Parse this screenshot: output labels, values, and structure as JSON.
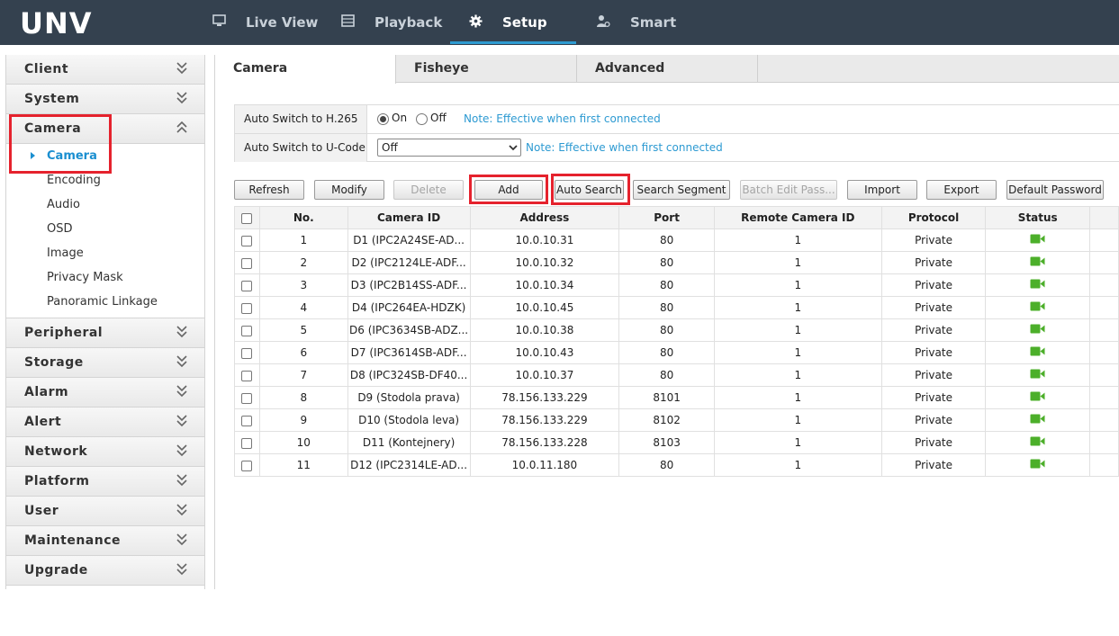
{
  "header": {
    "logo": "UNV",
    "nav": [
      {
        "label": "Live View",
        "icon": "monitor-icon"
      },
      {
        "label": "Playback",
        "icon": "film-icon"
      },
      {
        "label": "Setup",
        "icon": "gear-icon",
        "active": true
      },
      {
        "label": "Smart",
        "icon": "smart-person-icon"
      }
    ]
  },
  "sidebar": {
    "groups": [
      {
        "label": "Client"
      },
      {
        "label": "System"
      },
      {
        "label": "Camera",
        "expanded": true,
        "items": [
          "Camera",
          "Encoding",
          "Audio",
          "OSD",
          "Image",
          "Privacy Mask",
          "Panoramic Linkage"
        ],
        "active_item": "Camera"
      },
      {
        "label": "Peripheral"
      },
      {
        "label": "Storage"
      },
      {
        "label": "Alarm"
      },
      {
        "label": "Alert"
      },
      {
        "label": "Network"
      },
      {
        "label": "Platform"
      },
      {
        "label": "User"
      },
      {
        "label": "Maintenance"
      },
      {
        "label": "Upgrade"
      }
    ]
  },
  "tabs": [
    "Camera",
    "Fisheye",
    "Advanced"
  ],
  "settings": {
    "h265_label": "Auto Switch to H.265",
    "h265_on": "On",
    "h265_off": "Off",
    "h265_value": "On",
    "ucode_label": "Auto Switch to U-Code",
    "ucode_value": "Off",
    "note": "Note: Effective when first connected"
  },
  "toolbar": {
    "refresh": "Refresh",
    "modify": "Modify",
    "delete": "Delete",
    "add": "Add",
    "auto_search": "Auto Search",
    "search_segment": "Search Segment",
    "batch_edit": "Batch Edit Pass...",
    "import": "Import",
    "export": "Export",
    "default_password": "Default Password"
  },
  "table": {
    "columns": [
      "No.",
      "Camera ID",
      "Address",
      "Port",
      "Remote Camera ID",
      "Protocol",
      "Status"
    ],
    "rows": [
      [
        "1",
        "D1 (IPC2A24SE-AD...",
        "10.0.10.31",
        "80",
        "1",
        "Private"
      ],
      [
        "2",
        "D2 (IPC2124LE-ADF...",
        "10.0.10.32",
        "80",
        "1",
        "Private"
      ],
      [
        "3",
        "D3 (IPC2B14SS-ADF...",
        "10.0.10.34",
        "80",
        "1",
        "Private"
      ],
      [
        "4",
        "D4 (IPC264EA-HDZK)",
        "10.0.10.45",
        "80",
        "1",
        "Private"
      ],
      [
        "5",
        "D6 (IPC3634SB-ADZ...",
        "10.0.10.38",
        "80",
        "1",
        "Private"
      ],
      [
        "6",
        "D7 (IPC3614SB-ADF...",
        "10.0.10.43",
        "80",
        "1",
        "Private"
      ],
      [
        "7",
        "D8 (IPC324SB-DF40...",
        "10.0.10.37",
        "80",
        "1",
        "Private"
      ],
      [
        "8",
        "D9 (Stodola prava)",
        "78.156.133.229",
        "8101",
        "1",
        "Private"
      ],
      [
        "9",
        "D10 (Stodola leva)",
        "78.156.133.229",
        "8102",
        "1",
        "Private"
      ],
      [
        "10",
        "D11 (Kontejnery)",
        "78.156.133.228",
        "8103",
        "1",
        "Private"
      ],
      [
        "11",
        "D12 (IPC2314LE-AD...",
        "10.0.11.180",
        "80",
        "1",
        "Private"
      ]
    ],
    "status_icon": "camera-online-icon",
    "status_color": "#4caf2a"
  },
  "colors": {
    "topbar": "#34414f",
    "accent": "#1b8fd0",
    "highlight": "#e5222d"
  }
}
